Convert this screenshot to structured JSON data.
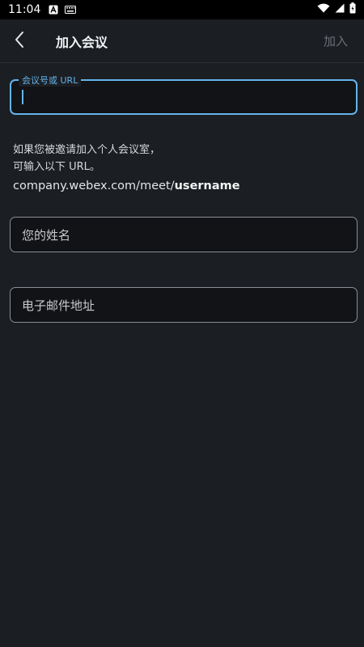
{
  "status_bar": {
    "time": "11:04",
    "icons": [
      "a-notification-icon",
      "keyboard-icon"
    ],
    "right_icons": [
      "wifi-icon",
      "signal-icon",
      "battery-icon"
    ]
  },
  "app_bar": {
    "back_icon": "chevron-left-icon",
    "title": "加入会议",
    "join_label": "加入"
  },
  "meeting_field": {
    "label": "会议号或 URL",
    "value": ""
  },
  "info": {
    "line1": "如果您被邀请加入个人会议室，",
    "line2": "可输入以下 URL。",
    "url_prefix": "company.webex.com/meet/",
    "url_suffix": "username"
  },
  "name_field": {
    "placeholder": "您的姓名",
    "value": ""
  },
  "email_field": {
    "placeholder": "电子邮件地址",
    "value": ""
  },
  "colors": {
    "background": "#1b1e22",
    "accent": "#64b4ec",
    "disabled_text": "#6c7076"
  }
}
